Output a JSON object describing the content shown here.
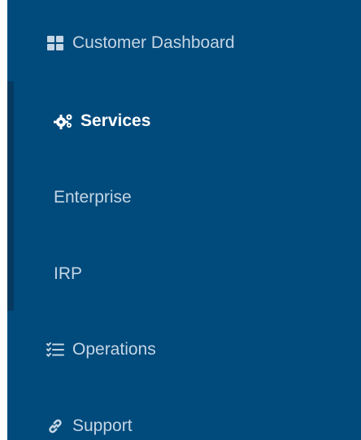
{
  "sidebar": {
    "items": [
      {
        "label": "Customer Dashboard",
        "icon": "dashboard-icon"
      },
      {
        "label": "Services",
        "icon": "cogs-icon"
      },
      {
        "label": "Enterprise"
      },
      {
        "label": "IRP"
      },
      {
        "label": "Operations",
        "icon": "list-icon"
      },
      {
        "label": "Support",
        "icon": "link-icon"
      }
    ]
  },
  "colors": {
    "sidebar_bg": "#004a7c",
    "active_bar": "#05395f",
    "text": "#c5d6e4",
    "active_text": "#ffffff"
  }
}
